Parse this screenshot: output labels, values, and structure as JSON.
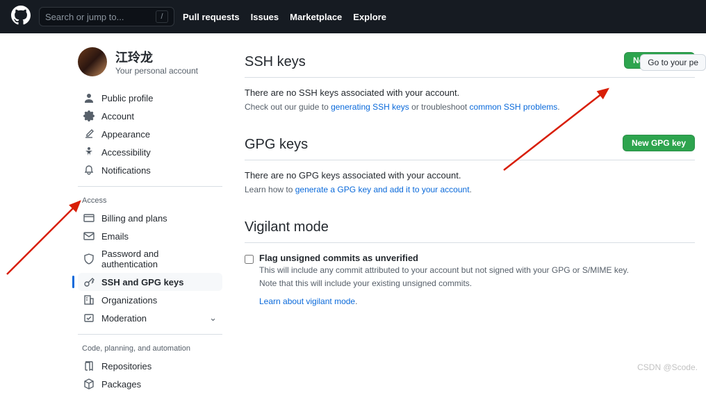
{
  "header": {
    "search_placeholder": "Search or jump to...",
    "nav": [
      "Pull requests",
      "Issues",
      "Marketplace",
      "Explore"
    ]
  },
  "user": {
    "name": "江玲龙",
    "sub": "Your personal account"
  },
  "go_button": "Go to your pe",
  "sidebar": {
    "items_top": [
      {
        "icon": "person",
        "label": "Public profile"
      },
      {
        "icon": "gear",
        "label": "Account"
      },
      {
        "icon": "brush",
        "label": "Appearance"
      },
      {
        "icon": "a11y",
        "label": "Accessibility"
      },
      {
        "icon": "bell",
        "label": "Notifications"
      }
    ],
    "section_access": "Access",
    "items_access": [
      {
        "icon": "card",
        "label": "Billing and plans"
      },
      {
        "icon": "mail",
        "label": "Emails"
      },
      {
        "icon": "shield",
        "label": "Password and authentication"
      },
      {
        "icon": "key",
        "label": "SSH and GPG keys",
        "active": true
      },
      {
        "icon": "org",
        "label": "Organizations"
      },
      {
        "icon": "mod",
        "label": "Moderation",
        "chev": true
      }
    ],
    "section_code": "Code, planning, and automation",
    "items_code": [
      {
        "icon": "repo",
        "label": "Repositories"
      },
      {
        "icon": "pkg",
        "label": "Packages"
      }
    ]
  },
  "ssh": {
    "title": "SSH keys",
    "button": "New SSH key",
    "empty": "There are no SSH keys associated with your account.",
    "guide_pre": "Check out our guide to ",
    "guide_link": "generating SSH keys",
    "guide_mid": " or troubleshoot ",
    "guide_link2": "common SSH problems",
    "guide_post": "."
  },
  "gpg": {
    "title": "GPG keys",
    "button": "New GPG key",
    "empty": "There are no GPG keys associated with your account.",
    "learn_pre": "Learn how to ",
    "learn_link": "generate a GPG key and add it to your account",
    "learn_post": "."
  },
  "vigilant": {
    "title": "Vigilant mode",
    "label": "Flag unsigned commits as unverified",
    "desc1": "This will include any commit attributed to your account but not signed with your GPG or S/MIME key.",
    "desc2": "Note that this will include your existing unsigned commits.",
    "learn": "Learn about vigilant mode"
  },
  "watermark": "CSDN @Scode."
}
